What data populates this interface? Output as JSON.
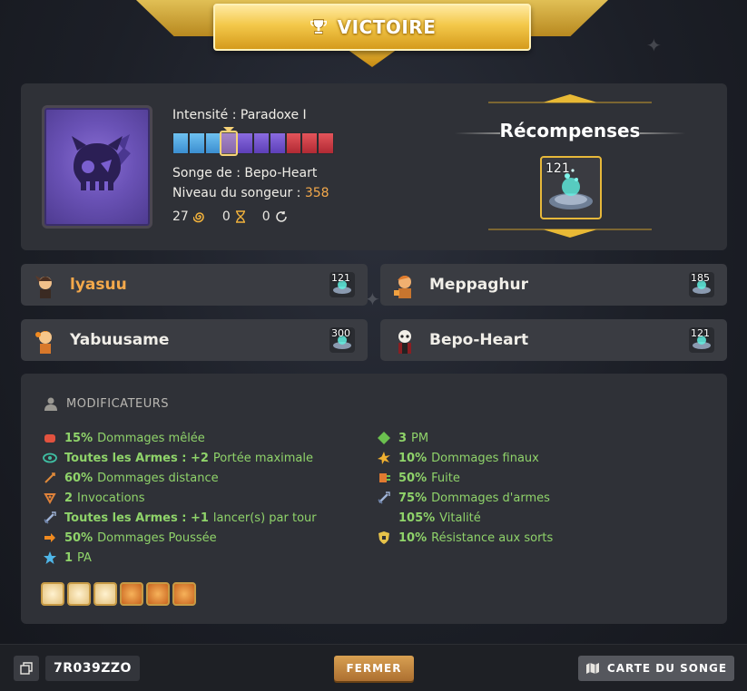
{
  "banner": {
    "title": "VICTOIRE",
    "icon": "trophy-icon"
  },
  "dream": {
    "intensity_label": "Intensité : Paradoxe I",
    "gauge": {
      "segments": [
        "blue",
        "blue",
        "blue",
        "purple",
        "purple",
        "purple",
        "purple",
        "red",
        "red",
        "red"
      ],
      "current_index": 3
    },
    "dreamer_label": "Songe de : Bepo-Heart",
    "level_label": "Niveau du songeur : ",
    "level_value": "358",
    "counters": [
      {
        "value": "27",
        "icon": "spiral-icon"
      },
      {
        "value": "0",
        "icon": "hourglass-icon"
      },
      {
        "value": "0",
        "icon": "refresh-icon"
      }
    ]
  },
  "rewards": {
    "title": "Récompenses",
    "item_count": "121",
    "item_icon": "dream-orb-icon"
  },
  "players": [
    {
      "name": "lyasuu",
      "item_count": "121",
      "self": true
    },
    {
      "name": "Meppaghur",
      "item_count": "185",
      "self": false
    },
    {
      "name": "Yabuusame",
      "item_count": "300",
      "self": false
    },
    {
      "name": "Bepo-Heart",
      "item_count": "121",
      "self": false
    }
  ],
  "modifiers": {
    "title": "MODIFICATEURS",
    "left": [
      {
        "bold": "15%",
        "text": "Dommages mêlée",
        "icon": "fist-icon",
        "color": "#e2523f"
      },
      {
        "bold": "Toutes les Armes : +2",
        "text": "Portée maximale",
        "icon": "eye-icon",
        "color": "#3fbfa3"
      },
      {
        "bold": "60%",
        "text": "Dommages distance",
        "icon": "bow-icon",
        "color": "#e08a3a"
      },
      {
        "bold": "2",
        "text": "Invocations",
        "icon": "summon-icon",
        "color": "#e0823a"
      },
      {
        "bold": "Toutes les Armes : +1",
        "text": "lancer(s) par tour",
        "icon": "sword-icon",
        "color": "#9fb3d6"
      },
      {
        "bold": "50%",
        "text": "Dommages Poussée",
        "icon": "arrow-icon",
        "color": "#f08a20"
      },
      {
        "bold": "1",
        "text": "PA",
        "icon": "star-icon",
        "color": "#4fb6e8"
      }
    ],
    "right": [
      {
        "bold": "3",
        "text": "PM",
        "icon": "diamond-icon",
        "color": "#6bc04f"
      },
      {
        "bold": "10%",
        "text": "Dommages finaux",
        "icon": "burst-icon",
        "color": "#f0b030"
      },
      {
        "bold": "50%",
        "text": "Fuite",
        "icon": "flee-icon",
        "color": "#e07a30"
      },
      {
        "bold": "75%",
        "text": "Dommages d'armes",
        "icon": "sword-icon",
        "color": "#9fb3d6"
      },
      {
        "bold": "105%",
        "text": "Vitalité",
        "icon": "heart-icon",
        "color": "#e23a4a"
      },
      {
        "bold": "10%",
        "text": "Résistance aux sorts",
        "icon": "shield-icon",
        "color": "#e6c24a"
      }
    ],
    "badges": [
      "light",
      "light",
      "light",
      "dark",
      "dark",
      "dark"
    ]
  },
  "footer": {
    "code": "7R039ZZO",
    "close_label": "FERMER",
    "map_label": "CARTE DU SONGE"
  }
}
